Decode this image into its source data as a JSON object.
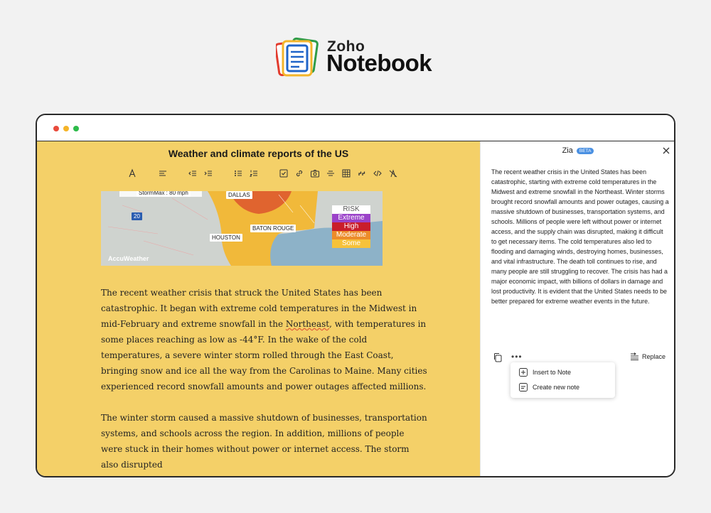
{
  "brand": {
    "company": "Zoho",
    "product": "Notebook"
  },
  "window": {
    "controls": [
      "close",
      "minimize",
      "maximize"
    ]
  },
  "note": {
    "title": "Weather and climate reports of the US",
    "toolbar": [
      "font-icon",
      "align-icon",
      "outdent-icon",
      "indent-icon",
      "bullet-list-icon",
      "numbered-list-icon",
      "checklist-icon",
      "link-icon",
      "camera-icon",
      "strikethrough-icon",
      "table-icon",
      "quote-icon",
      "code-icon",
      "clear-format-icon"
    ],
    "map": {
      "labels": {
        "stormmax": "StormMax : 80 mph",
        "dallas": "DALLAS",
        "houston": "HOUSTON",
        "baton_rouge": "BATON ROUGE",
        "highway_20": "20",
        "watermark": "AccuWeather"
      },
      "legend": {
        "title": "RISK",
        "levels": [
          "Extreme",
          "High",
          "Moderate",
          "Some"
        ]
      }
    },
    "paragraph1_before": "The recent weather crisis that struck the United States has been catastrophic. It began with extreme cold temperatures in the Midwest in mid-February and extreme snowfall in the ",
    "paragraph1_underlined": "Northeast",
    "paragraph1_after": ", with temperatures in some places reaching as low as -44°F. In the wake of the cold temperatures, a severe winter storm rolled through the East Coast, bringing snow and ice all the way from the Carolinas to Maine. Many cities experienced record snowfall amounts and power outages affected millions.",
    "paragraph2": "The winter storm caused a massive shutdown of businesses, transportation systems, and schools across the region. In addition, millions of people were stuck in their homes without power or internet access. The storm also disrupted"
  },
  "zia": {
    "title": "Zia",
    "badge": "BETA",
    "response": "The recent weather crisis in the United States has been catastrophic, starting with extreme cold temperatures in the Midwest and extreme snowfall in the Northeast. Winter storms brought record snowfall amounts and power outages, causing a massive shutdown of businesses, transportation systems, and schools. Millions of people were left without power or internet access, and the supply chain was disrupted, making it difficult to get necessary items. The cold temperatures also led to flooding and damaging winds, destroying homes, businesses, and vital infrastructure. The death toll continues to rise, and many people are still struggling to recover. The crisis has had a major economic impact, with billions of dollars in damage and lost productivity. It is evident that the United States needs to be better prepared for extreme weather events in the future.",
    "replace_label": "Replace",
    "menu": {
      "insert": "Insert to Note",
      "create": "Create new note"
    }
  },
  "colors": {
    "editor_bg": "#f4d068",
    "accent": "#4a90e2",
    "risk_extreme": "#9b43c9",
    "risk_high": "#c91e2b",
    "risk_moderate": "#ec8c2a",
    "risk_some": "#f6c23a"
  }
}
